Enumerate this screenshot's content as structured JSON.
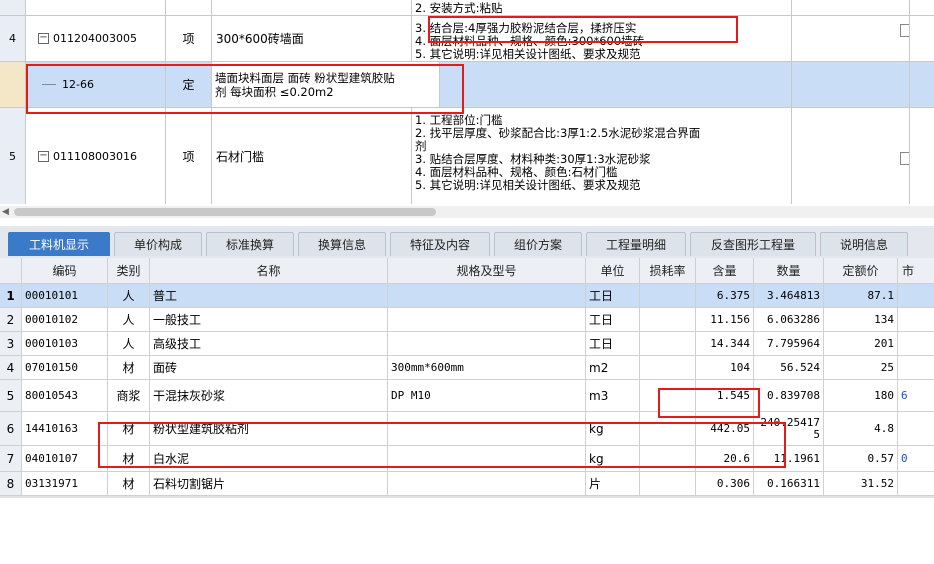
{
  "top_grid": {
    "row0_tail": [
      "2. 安装方式:粘贴"
    ],
    "row4": {
      "num": "4",
      "toggle": "−",
      "code": "011204003005",
      "type": "项",
      "name": "300*600砖墙面",
      "desc_lines": [
        "3. 结合层:4厚强力胶粉泥结合层，揉挤压实",
        "4. 面层材料品种、规格、颜色:300*600墙砖",
        "5. 其它说明:详见相关设计图纸、要求及规范"
      ]
    },
    "sub_row": {
      "code": "12-66",
      "type": "定",
      "name_lines": [
        "墙面块料面层 面砖 粉状型建筑胶贴",
        "剂 每块面积 ≤0.20m2"
      ]
    },
    "row5": {
      "num": "5",
      "toggle": "−",
      "code": "011108003016",
      "type": "项",
      "name": "石材门槛",
      "desc_lines": [
        "1. 工程部位:门槛",
        "2. 找平层厚度、砂浆配合比:3厚1:2.5水泥砂浆混合界面",
        "剂",
        "3. 贴结合层厚度、材料种类:30厚1:3水泥砂浆",
        "4. 面层材料品种、规格、颜色:石材门槛",
        "5. 其它说明:详见相关设计图纸、要求及规范"
      ]
    }
  },
  "tabs": [
    {
      "label": "工料机显示",
      "active": true
    },
    {
      "label": "单价构成",
      "active": false
    },
    {
      "label": "标准换算",
      "active": false
    },
    {
      "label": "换算信息",
      "active": false
    },
    {
      "label": "特征及内容",
      "active": false
    },
    {
      "label": "组价方案",
      "active": false
    },
    {
      "label": "工程量明细",
      "active": false
    },
    {
      "label": "反查图形工程量",
      "active": false
    },
    {
      "label": "说明信息",
      "active": false
    }
  ],
  "table": {
    "headers": [
      "编码",
      "类别",
      "名称",
      "规格及型号",
      "单位",
      "损耗率",
      "含量",
      "数量",
      "定额价",
      "市"
    ],
    "rows": [
      {
        "num": "1",
        "code": "00010101",
        "cat": "人",
        "name": "普工",
        "spec": "",
        "unit": "工日",
        "loss": "",
        "content": "6.375",
        "qty": "3.464813",
        "price": "87.1",
        "market": ""
      },
      {
        "num": "2",
        "code": "00010102",
        "cat": "人",
        "name": "一般技工",
        "spec": "",
        "unit": "工日",
        "loss": "",
        "content": "11.156",
        "qty": "6.063286",
        "price": "134",
        "market": ""
      },
      {
        "num": "3",
        "code": "00010103",
        "cat": "人",
        "name": "高级技工",
        "spec": "",
        "unit": "工日",
        "loss": "",
        "content": "14.344",
        "qty": "7.795964",
        "price": "201",
        "market": ""
      },
      {
        "num": "4",
        "code": "07010150",
        "cat": "材",
        "name": "面砖",
        "spec": "300mm*600mm",
        "unit": "m2",
        "loss": "",
        "content": "104",
        "qty": "56.524",
        "price": "25",
        "market": ""
      },
      {
        "num": "5",
        "code": "80010543",
        "cat": "商浆",
        "name": "干混抹灰砂浆",
        "spec": "DP M10",
        "unit": "m3",
        "loss": "",
        "content": "1.545",
        "qty": "0.839708",
        "price": "180",
        "market": "6"
      },
      {
        "num": "6",
        "code": "14410163",
        "cat": "材",
        "name": "粉状型建筑胶粘剂",
        "spec": "",
        "unit": "kg",
        "loss": "",
        "content": "442.05",
        "qty": "240.25417 5",
        "price": "4.8",
        "market": ""
      },
      {
        "num": "7",
        "code": "04010107",
        "cat": "材",
        "name": "白水泥",
        "spec": "",
        "unit": "kg",
        "loss": "",
        "content": "20.6",
        "qty": "11.1961",
        "price": "0.57",
        "market": "0"
      },
      {
        "num": "8",
        "code": "03131971",
        "cat": "材",
        "name": "石料切割锯片",
        "spec": "",
        "unit": "片",
        "loss": "",
        "content": "0.306",
        "qty": "0.166311",
        "price": "31.52",
        "market": ""
      }
    ]
  },
  "colors": {
    "accent": "#3b79c9",
    "highlight": "#e51b1b",
    "selected": "#c9ddf6"
  }
}
